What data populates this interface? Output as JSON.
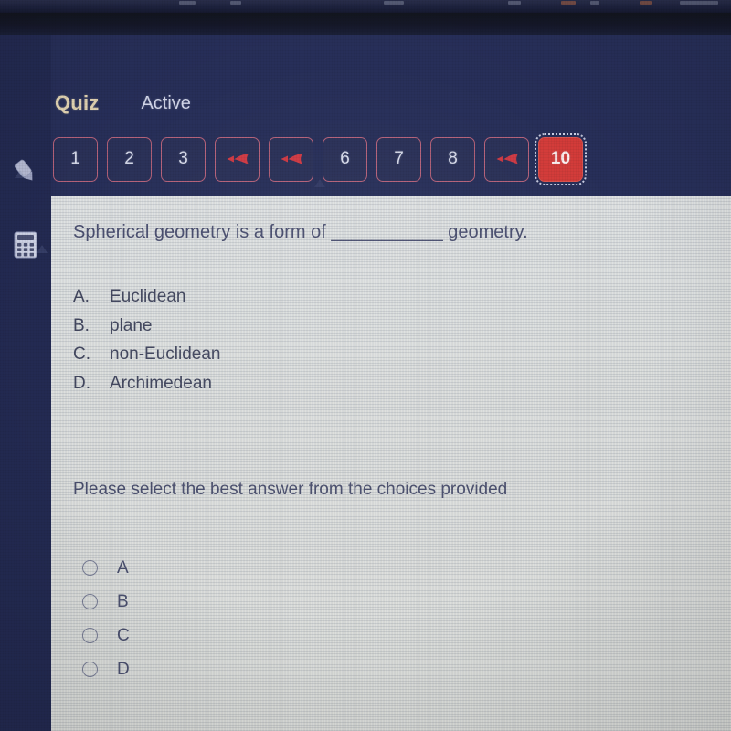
{
  "window": {
    "top_strip_note": "cut-off browser toolbar remnants"
  },
  "sidebar": {
    "items": [
      {
        "name": "pencil-tool",
        "icon": "pencil-icon"
      },
      {
        "name": "calculator-tool",
        "icon": "calculator-icon"
      }
    ]
  },
  "header": {
    "title": "Quiz",
    "status": "Active",
    "title_color": "#e4d6b4",
    "status_color": "#d3d7ea"
  },
  "question_nav": {
    "current_color": "#d33b39",
    "border_color": "#b5627a",
    "buttons": [
      {
        "label": "1",
        "type": "number",
        "current": false
      },
      {
        "label": "2",
        "type": "number",
        "current": false
      },
      {
        "label": "3",
        "type": "number",
        "current": false
      },
      {
        "label": "",
        "type": "flag",
        "current": false,
        "icon": "left-arrow-flag-icon"
      },
      {
        "label": "",
        "type": "flag",
        "current": false,
        "icon": "left-arrow-flag-icon"
      },
      {
        "label": "6",
        "type": "number",
        "current": false
      },
      {
        "label": "7",
        "type": "number",
        "current": false
      },
      {
        "label": "8",
        "type": "number",
        "current": false
      },
      {
        "label": "",
        "type": "flag",
        "current": false,
        "icon": "left-arrow-flag-icon"
      },
      {
        "label": "10",
        "type": "number",
        "current": true
      }
    ]
  },
  "question": {
    "prompt": "Spherical geometry is a form of ___________ geometry.",
    "choices": [
      {
        "letter": "A.",
        "text": "Euclidean"
      },
      {
        "letter": "B.",
        "text": "plane"
      },
      {
        "letter": "C.",
        "text": "non-Euclidean"
      },
      {
        "letter": "D.",
        "text": "Archimedean"
      }
    ],
    "instruction": "Please select the best answer from the choices provided",
    "answer_options": [
      {
        "label": "A",
        "selected": false
      },
      {
        "label": "B",
        "selected": false
      },
      {
        "label": "C",
        "selected": false
      },
      {
        "label": "D",
        "selected": false
      }
    ]
  },
  "colors": {
    "app_navy": "#272f59",
    "rail_navy": "#232a52",
    "panel_bg": "#d5d8d6",
    "text": "#4a4f70",
    "accent_red": "#d33b39"
  }
}
